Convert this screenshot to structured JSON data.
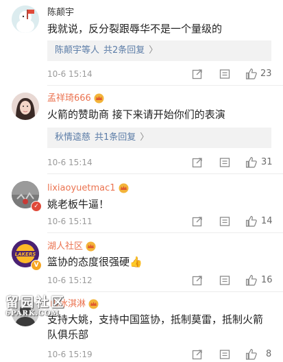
{
  "comments": [
    {
      "username": "陈颠宇",
      "text": "我就说，反分裂跟辱华不是一个量级的",
      "reply": {
        "who": "陈颠宇等人",
        "count": "共2条回复",
        "arrow": "〉"
      },
      "time": "10-6 15:14",
      "likes": "23"
    },
    {
      "username": "孟祥琦666",
      "text": "火箭的赞助商 接下来请开始你们的表演",
      "reply": {
        "who": "秋情逵慈",
        "count": "共1条回复",
        "arrow": "〉"
      },
      "time": "10-6 15:14",
      "likes": "31"
    },
    {
      "username": "lixiaoyuetmac1",
      "text": "姚老板牛逼！",
      "time": "10-6 15:11",
      "likes": "14"
    },
    {
      "username": "湖人社区",
      "text": "篮协的态度很强硬👍",
      "time": "10-6 15:12",
      "likes": "16"
    },
    {
      "username": "山冰淇淋",
      "text": "支持大姚，支持中国篮协，抵制莫雷，抵制火箭队俱乐部",
      "time": "10-6 15:19",
      "likes": "8"
    }
  ],
  "watermark": {
    "line1": "留园社区",
    "line2": "6PARK.COM"
  },
  "colors": {
    "username_vip": "#eb7350",
    "link": "#5b7ca7",
    "meta": "#9a9a9a",
    "reply_bg": "#f2f2f2"
  }
}
